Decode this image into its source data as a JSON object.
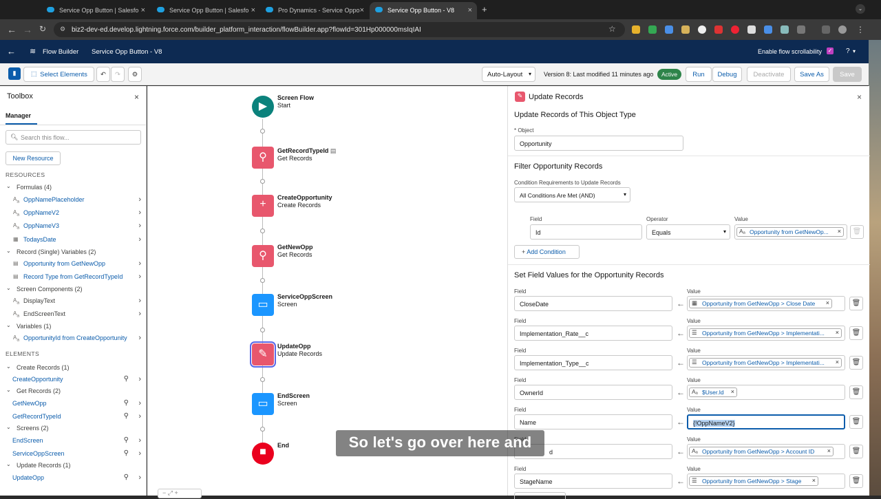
{
  "browser": {
    "tabs": [
      {
        "label": "Service Opp Button | Salesfo",
        "active": false
      },
      {
        "label": "Service Opp Button | Salesfo",
        "active": false
      },
      {
        "label": "Pro Dynamics - Service Oppo",
        "active": false
      },
      {
        "label": "Service Opp Button - V8",
        "active": true
      }
    ],
    "url": "biz2-dev-ed.develop.lightning.force.com/builder_platform_interaction/flowBuilder.app?flowId=301Hp000000msIqIAI",
    "colors": {
      "red": "#ff5f57",
      "yellow": "#febc2e",
      "green": "#28c840"
    }
  },
  "app": {
    "title": "Flow Builder",
    "flow_name": "Service Opp Button - V8",
    "scroll_label": "Enable flow scrollability",
    "help": "?"
  },
  "toolbar": {
    "select_elements": "Select Elements",
    "auto_layout": "Auto-Layout",
    "version_text": "Version 8: Last modified 11 minutes ago",
    "active_badge": "Active",
    "run": "Run",
    "debug": "Debug",
    "deactivate": "Deactivate",
    "save_as": "Save As",
    "save": "Save"
  },
  "toolbox": {
    "title": "Toolbox",
    "tab": "Manager",
    "search_placeholder": "Search this flow...",
    "new_resource": "New Resource",
    "resources_header": "RESOURCES",
    "elements_header": "ELEMENTS",
    "resource_groups": [
      {
        "label": "Formulas (4)",
        "items": [
          "OppNamePlaceholder",
          "OppNameV2",
          "OppNameV3",
          "TodaysDate"
        ]
      },
      {
        "label": "Record (Single) Variables (2)",
        "items": [
          "Opportunity from GetNewOpp",
          "Record Type from GetRecordTypeId"
        ]
      },
      {
        "label": "Screen Components (2)",
        "items": [
          "DisplayText",
          "EndScreenText"
        ]
      },
      {
        "label": "Variables (1)",
        "items": [
          "OpportunityId from CreateOpportunity"
        ]
      }
    ],
    "element_groups": [
      {
        "label": "Create Records (1)",
        "items": [
          "CreateOpportunity"
        ]
      },
      {
        "label": "Get Records (2)",
        "items": [
          "GetNewOpp",
          "GetRecordTypeId"
        ]
      },
      {
        "label": "Screens (2)",
        "items": [
          "EndScreen",
          "ServiceOppScreen"
        ]
      },
      {
        "label": "Update Records (1)",
        "items": [
          "UpdateOpp"
        ]
      }
    ]
  },
  "canvas": {
    "nodes": [
      {
        "name": "Screen Flow",
        "type": "Start",
        "color": "#0b827c",
        "icon": "play-icon"
      },
      {
        "name": "GetRecordTypeId",
        "type": "Get Records",
        "color": "#e8576d",
        "icon": "search-icon"
      },
      {
        "name": "CreateOpportunity",
        "type": "Create Records",
        "color": "#e8576d",
        "icon": "plus-icon"
      },
      {
        "name": "GetNewOpp",
        "type": "Get Records",
        "color": "#e8576d",
        "icon": "search-icon"
      },
      {
        "name": "ServiceOppScreen",
        "type": "Screen",
        "color": "#1b96ff",
        "icon": "screen-icon"
      },
      {
        "name": "UpdateOpp",
        "type": "Update Records",
        "color": "#e8576d",
        "icon": "edit-icon"
      },
      {
        "name": "EndScreen",
        "type": "Screen",
        "color": "#1b96ff",
        "icon": "screen-icon"
      },
      {
        "name": "End",
        "type": "",
        "color": "#ea001e",
        "icon": "stop-icon"
      }
    ]
  },
  "panel": {
    "title": "Update Records",
    "subtitle": "Update Records of This Object Type",
    "object_label": "* Object",
    "object_value": "Opportunity",
    "filter_header": "Filter Opportunity Records",
    "condition_label": "Condition Requirements to Update Records",
    "condition_value": "All Conditions Are Met (AND)",
    "filter_row": {
      "field_label": "Field",
      "field": "Id",
      "operator_label": "Operator",
      "operator": "Equals",
      "value_label": "Value",
      "value": "Opportunity from GetNewOp..."
    },
    "add_condition": "Add Condition",
    "set_header": "Set Field Values for the Opportunity Records",
    "field_label": "Field",
    "value_label": "Value",
    "assignments": [
      {
        "field": "CloseDate",
        "value": "Opportunity from GetNewOpp > Close Date"
      },
      {
        "field": "Implementation_Rate__c",
        "value": "Opportunity from GetNewOpp > Implementati..."
      },
      {
        "field": "Implementation_Type__c",
        "value": "Opportunity from GetNewOpp > Implementati..."
      },
      {
        "field": "OwnerId",
        "value": "$User.Id"
      },
      {
        "field": "Name",
        "value": "{!OppNameV2}"
      },
      {
        "field": "d",
        "value": "Opportunity from GetNewOpp > Account ID"
      },
      {
        "field": "StageName",
        "value": "Opportunity from GetNewOpp > Stage"
      }
    ]
  },
  "caption": "So let's go over here and"
}
